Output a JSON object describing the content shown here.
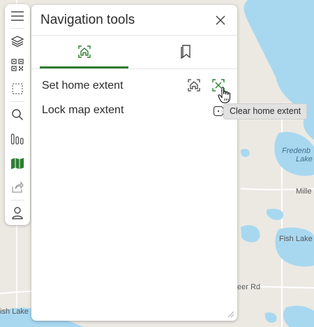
{
  "map": {
    "labels": [
      "Fredenb",
      "Lake",
      "Mille",
      "Fish Lake",
      "eer Rd",
      "ish Lake"
    ]
  },
  "toolbar": {
    "items": [
      {
        "name": "menu-icon"
      },
      {
        "name": "layers-icon"
      },
      {
        "name": "qr-code-icon"
      },
      {
        "name": "select-area-icon"
      },
      {
        "name": "search-icon"
      },
      {
        "name": "legend-icon"
      },
      {
        "name": "map-icon",
        "active": true
      },
      {
        "name": "share-icon"
      },
      {
        "name": "user-icon"
      }
    ]
  },
  "panel": {
    "title": "Navigation tools",
    "tabs": [
      {
        "name": "home-icon",
        "active": true
      },
      {
        "name": "bookmark-icon",
        "active": false
      }
    ],
    "rows": [
      {
        "label": "Set home extent"
      },
      {
        "label": "Lock map extent"
      }
    ]
  },
  "tooltip": {
    "text": "Clear home extent"
  },
  "colors": {
    "accent": "#2e7d32",
    "water": "#a8d8f0",
    "land": "#ece9e3"
  }
}
